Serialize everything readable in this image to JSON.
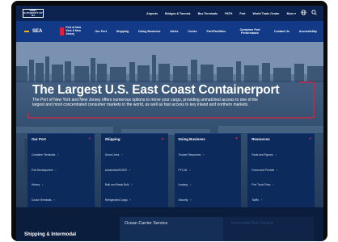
{
  "header": {
    "logo_text": "PORT AUTHORITY NY NJ",
    "top_links": [
      "Airports",
      "Bridges & Tunnels",
      "Bus Terminals",
      "PATH",
      "Port",
      "World Trade Center",
      "More"
    ],
    "icons": [
      "globe-icon",
      "search-icon"
    ]
  },
  "nav": {
    "section_label": "SEA",
    "brand_text": "Port of New York & New Jersey",
    "items": [
      "Our Port",
      "Shipping",
      "Doing Business",
      "Alerts",
      "Cruise",
      "Port/Facilities",
      "Container Port Performance",
      "Contact Us",
      "Accessibility"
    ]
  },
  "hero": {
    "title": "The Largest U.S. East Coast Containerport",
    "subtitle": "The Port of New York and New Jersey offers numerous options to move your cargo, providing unmatched access to one of the largest and most concentrated consumer markets in the world, as well as fast access to key inland and northern markets."
  },
  "cards": [
    {
      "title": "Our Port",
      "items": [
        "Container Terminals",
        "Port Development",
        "History",
        "Cruise Terminals"
      ]
    },
    {
      "title": "Shipping",
      "items": [
        "Gross Lines",
        "Automotive/RORO",
        "Bulk and Break Bulk",
        "Refrigerated Cargo"
      ]
    },
    {
      "title": "Doing Business",
      "items": [
        "Trucker Resources",
        "PTC-BI",
        "Leasing",
        "Security"
      ]
    },
    {
      "title": "Resources",
      "items": [
        "Facts and Figures",
        "Forms and Permits",
        "Port Truck Pass",
        "Tariffs"
      ]
    }
  ],
  "bottom": {
    "left_text": "Shipping & Intermodal",
    "mid_text": "Ocean Carrier Service",
    "right_text": "Intermodal Rail Service"
  },
  "colors": {
    "top_bar": "#0c2350",
    "nav_bar": "#123a86",
    "card": "#0c2a5c",
    "accent_red": "#e0203a",
    "accent_yellow": "#ffb400"
  }
}
